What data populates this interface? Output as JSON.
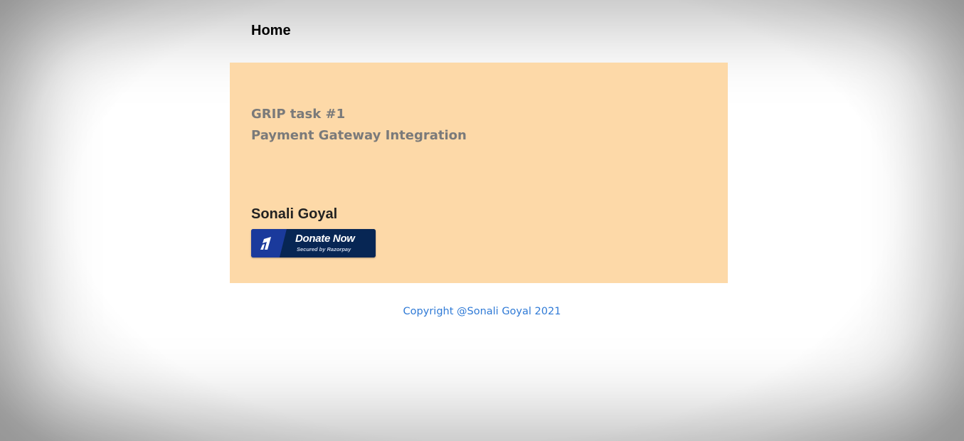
{
  "nav": {
    "home_label": "Home"
  },
  "card": {
    "heading_line1": "GRIP task #1",
    "heading_line2": "Payment Gateway Integration",
    "name": "Sonali Goyal",
    "donate_button": {
      "label": "Donate Now",
      "sublabel": "Secured by Razorpay",
      "icon": "razorpay-logo-icon"
    }
  },
  "footer": {
    "copyright": "Copyright @Sonali Goyal 2021"
  },
  "colors": {
    "card_background": "#fdd9a8",
    "heading_text": "#7a7a7a",
    "button_dark": "#072654",
    "button_accent": "#3395ff",
    "footer_link": "#2f7ad6"
  }
}
